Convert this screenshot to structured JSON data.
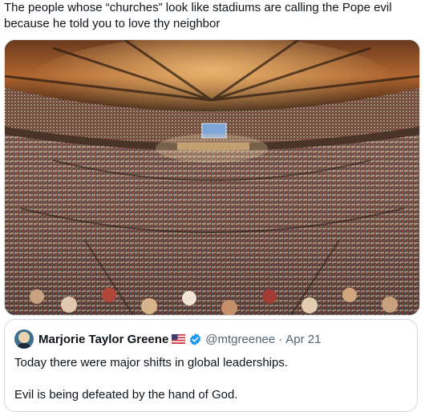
{
  "post": {
    "text_line1": "The people whose “churches” look like stadiums are calling the Pope evil",
    "text_line2": "because he told you to love thy neighbor"
  },
  "media": {
    "icon": "arena-crowd-photo"
  },
  "quoted_post": {
    "author_name": "Marjorie Taylor Greene",
    "flag_icon": "us-flag-icon",
    "verified_icon": "verified-badge-icon",
    "handle": "@mtgreenee",
    "separator": "·",
    "date": "Apr 21",
    "line1": "Today there were major shifts in global leaderships.",
    "line2": "Evil is being defeated by the hand of God."
  },
  "colors": {
    "verified": "#1d9bf0",
    "secondary_text": "#536471",
    "border": "#cfd9de"
  }
}
